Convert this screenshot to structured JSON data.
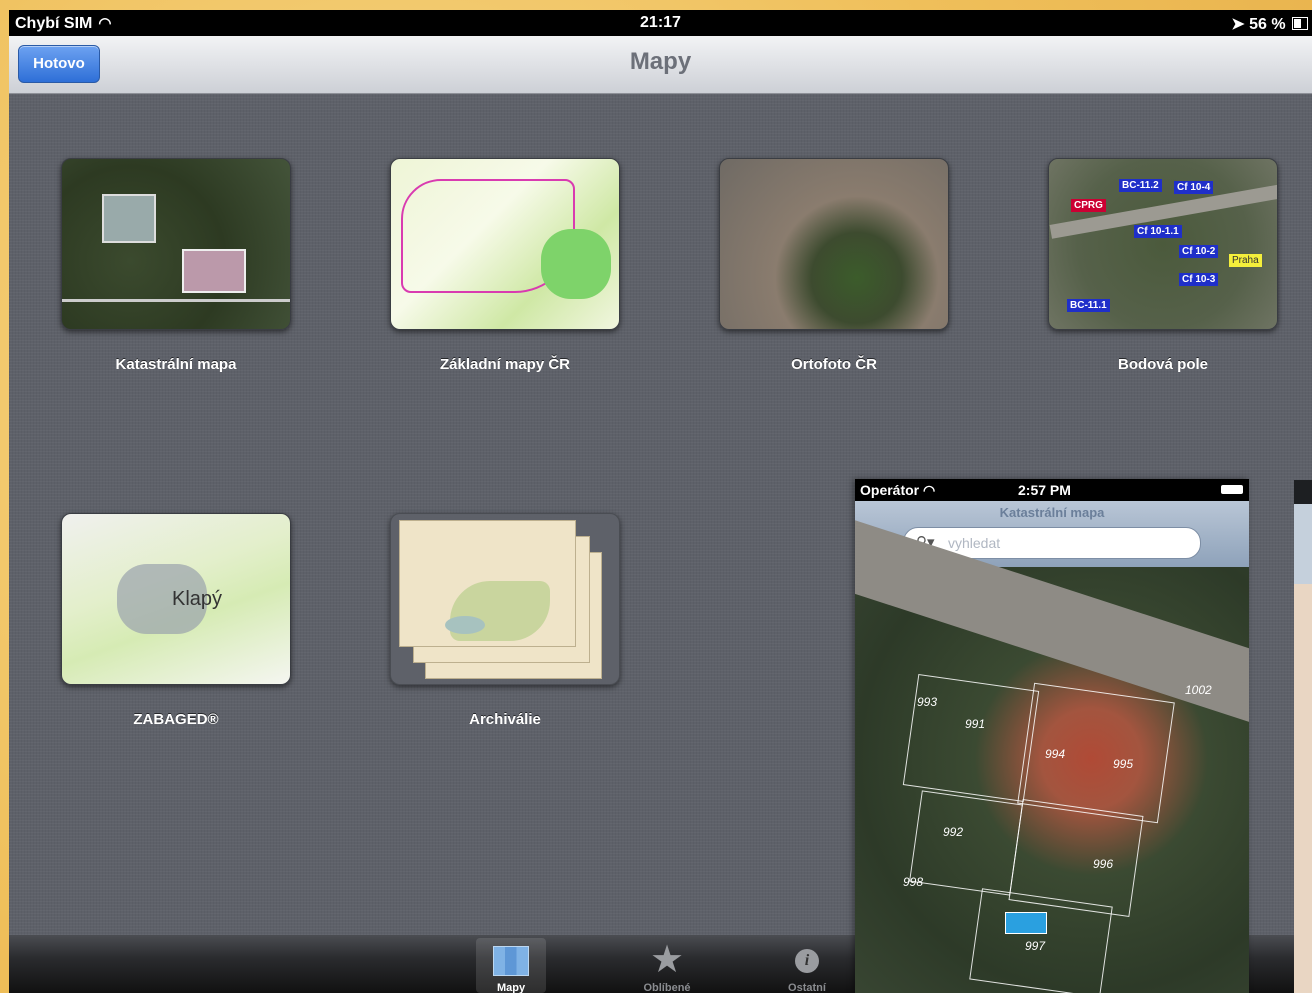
{
  "status_bar": {
    "carrier": "Chybí SIM",
    "time": "21:17",
    "battery": "56 %"
  },
  "nav": {
    "title": "Mapy",
    "done_label": "Hotovo"
  },
  "tiles": [
    {
      "label": "Katastrální mapa"
    },
    {
      "label": "Základní mapy ČR"
    },
    {
      "label": "Ortofoto ČR"
    },
    {
      "label": "Bodová pole",
      "tags": [
        "CPRG",
        "BC-11.2",
        "Cf 10-4",
        "Cf 10-1.1",
        "Cf 10-2",
        "Cf 10-3",
        "BC-11.1",
        "Praha"
      ]
    },
    {
      "label": "ZABAGED®",
      "map_name": "Klapý"
    },
    {
      "label": "Archiválie"
    }
  ],
  "tabbar": {
    "items": [
      {
        "label": "Mapy"
      },
      {
        "label": "Oblíbené"
      },
      {
        "label": "Ostatní"
      }
    ]
  },
  "phone_overlay": {
    "carrier": "Operátor",
    "time": "2:57 PM",
    "title": "Katastrální mapa",
    "search_placeholder": "vyhledat",
    "parcel_numbers": [
      "993",
      "991",
      "994",
      "995",
      "992",
      "998",
      "996",
      "997",
      "1002"
    ]
  }
}
